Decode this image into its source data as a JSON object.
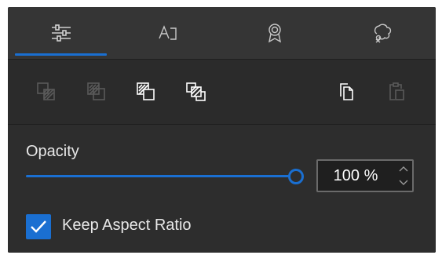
{
  "tabs": [
    {
      "icon": "sliders-icon",
      "active": true
    },
    {
      "icon": "text-box-icon",
      "active": false
    },
    {
      "icon": "award-icon",
      "active": false
    },
    {
      "icon": "palette-icon",
      "active": false
    }
  ],
  "toolbar": {
    "tools": [
      {
        "icon": "send-to-back-icon",
        "enabled": false
      },
      {
        "icon": "send-backward-icon",
        "enabled": false
      },
      {
        "icon": "bring-forward-icon",
        "enabled": true
      },
      {
        "icon": "bring-to-front-icon",
        "enabled": true
      },
      {
        "icon": "copy-icon",
        "enabled": true
      },
      {
        "icon": "paste-icon",
        "enabled": false
      }
    ]
  },
  "opacity": {
    "label": "Opacity",
    "value": 100,
    "display": "100 %"
  },
  "aspect": {
    "label": "Keep Aspect Ratio",
    "checked": true
  },
  "colors": {
    "accent": "#1a6fd1",
    "panel": "#2b2b2b",
    "icon_enabled": "#ffffff",
    "icon_disabled": "#5a5a5a"
  }
}
